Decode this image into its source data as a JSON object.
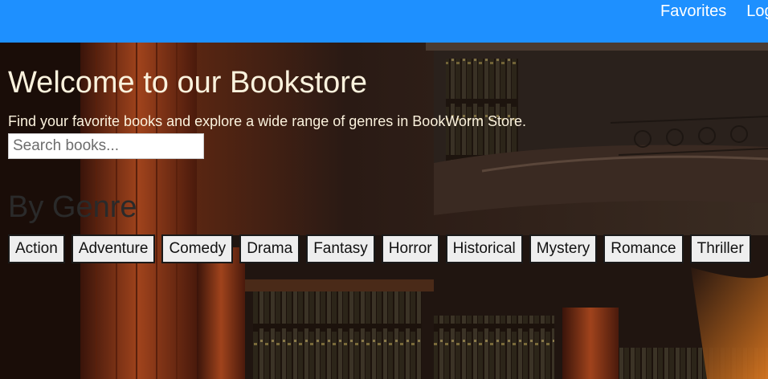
{
  "nav": {
    "links": [
      "Favorites",
      "Log"
    ]
  },
  "hero": {
    "title": "Welcome to our Bookstore",
    "subtitle": "Find your favorite books and explore a wide range of genres in BookWorm Store.",
    "search_placeholder": "Search books..."
  },
  "genres": {
    "heading": "By Genre",
    "items": [
      "Action",
      "Adventure",
      "Comedy",
      "Drama",
      "Fantasy",
      "Horror",
      "Historical",
      "Mystery",
      "Romance",
      "Thriller"
    ]
  },
  "colors": {
    "topbar": "#1e90ff",
    "hero_text": "#fbf2dd",
    "genre_heading": "#2a2a2a"
  }
}
